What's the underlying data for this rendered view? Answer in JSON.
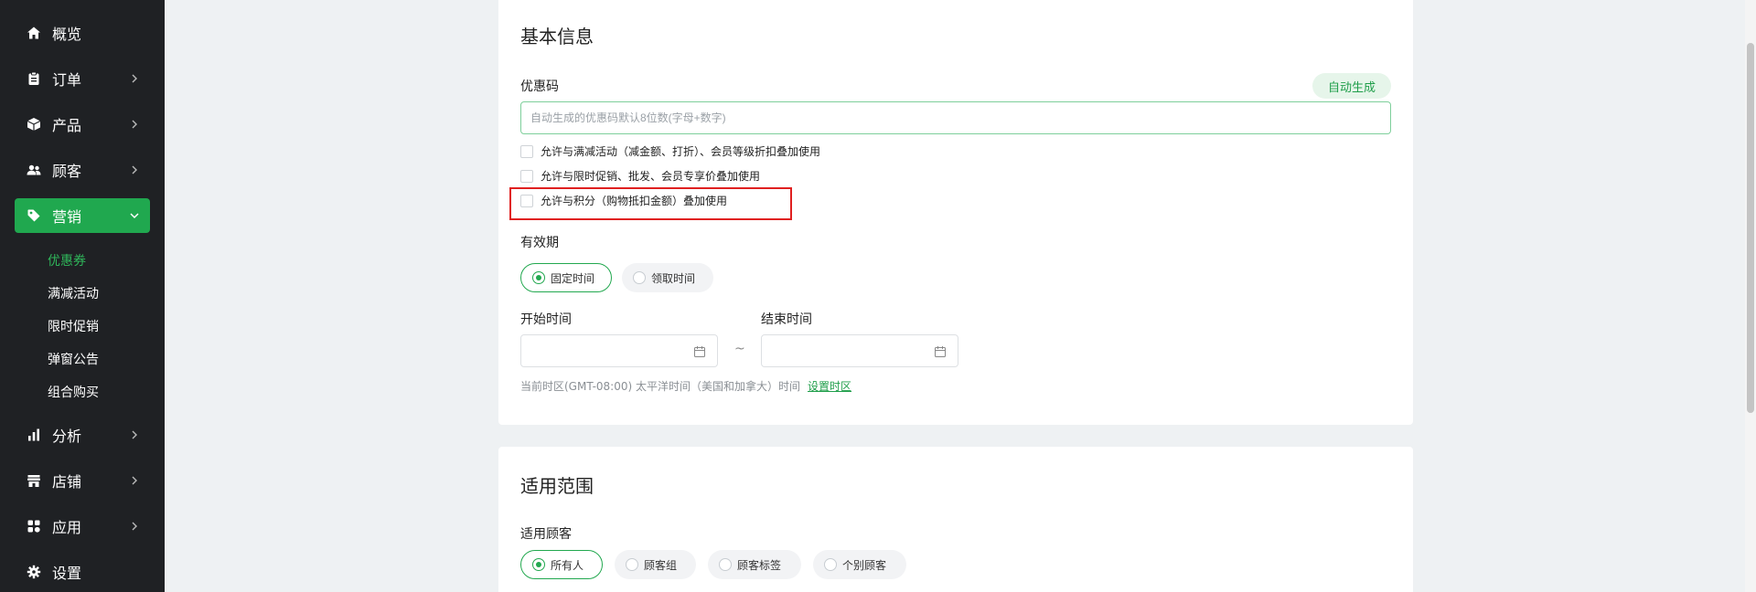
{
  "sidebar": {
    "items": [
      {
        "label": "概览",
        "icon": "home-icon"
      },
      {
        "label": "订单",
        "icon": "clipboard-icon"
      },
      {
        "label": "产品",
        "icon": "box-icon"
      },
      {
        "label": "顾客",
        "icon": "users-icon"
      },
      {
        "label": "营销",
        "icon": "tag-icon",
        "active": true
      },
      {
        "label": "分析",
        "icon": "bar-chart-icon"
      },
      {
        "label": "店铺",
        "icon": "store-icon"
      },
      {
        "label": "应用",
        "icon": "grid-icon"
      },
      {
        "label": "设置",
        "icon": "gear-icon"
      }
    ],
    "sub_items": [
      {
        "label": "优惠券",
        "active": true
      },
      {
        "label": "满减活动"
      },
      {
        "label": "限时促销"
      },
      {
        "label": "弹窗公告"
      },
      {
        "label": "组合购买"
      }
    ]
  },
  "basic": {
    "title": "基本信息",
    "code_label": "优惠码",
    "auto_generate": "自动生成",
    "code_placeholder": "自动生成的优惠码默认8位数(字母+数字)",
    "checkboxes": [
      "允许与满减活动（减金额、打折）、会员等级折扣叠加使用",
      "允许与限时促销、批发、会员专享价叠加使用",
      "允许与积分（购物抵扣金额）叠加使用"
    ],
    "validity_label": "有效期",
    "validity_options": [
      "固定时间",
      "领取时间"
    ],
    "start_label": "开始时间",
    "end_label": "结束时间",
    "tilde": "~",
    "timezone_text": "当前时区(GMT-08:00) 太平洋时间（美国和加拿大）时间",
    "timezone_link": "设置时区"
  },
  "scope": {
    "title": "适用范围",
    "customer_label": "适用顾客",
    "customer_options": [
      "所有人",
      "顾客组",
      "顾客标签",
      "个别顾客"
    ]
  },
  "colors": {
    "accent": "#20a84f",
    "sidebar_bg": "#1f2124",
    "highlight": "#e02020"
  }
}
